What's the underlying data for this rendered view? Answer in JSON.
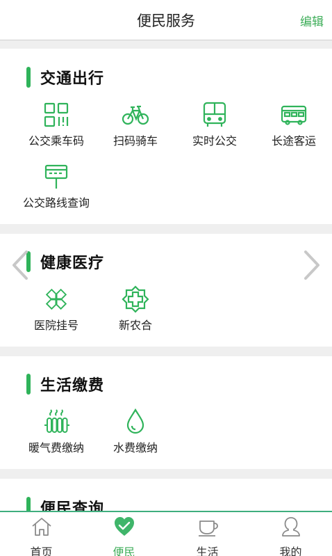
{
  "header": {
    "title": "便民服务",
    "edit_label": "编辑"
  },
  "colors": {
    "accent": "#2fb35a",
    "accent_light": "#3fae5a",
    "inactive": "#888888"
  },
  "sections": [
    {
      "title": "交通出行",
      "items": [
        {
          "label": "公交乘车码",
          "icon": "qr-code-icon"
        },
        {
          "label": "扫码骑车",
          "icon": "bicycle-icon"
        },
        {
          "label": "实时公交",
          "icon": "bus-icon"
        },
        {
          "label": "长途客运",
          "icon": "coach-icon"
        },
        {
          "label": "公交路线查询",
          "icon": "bus-stop-sign-icon"
        }
      ]
    },
    {
      "title": "健康医疗",
      "items": [
        {
          "label": "医院挂号",
          "icon": "medical-cross-icon"
        },
        {
          "label": "新农合",
          "icon": "health-badge-icon"
        }
      ]
    },
    {
      "title": "生活缴费",
      "items": [
        {
          "label": "暖气费缴纳",
          "icon": "radiator-icon"
        },
        {
          "label": "水费缴纳",
          "icon": "water-drop-icon"
        }
      ]
    },
    {
      "title": "便民查询",
      "items": []
    }
  ],
  "tabbar": [
    {
      "label": "首页",
      "icon": "home-icon",
      "active": false
    },
    {
      "label": "便民",
      "icon": "heart-icon",
      "active": true
    },
    {
      "label": "生活",
      "icon": "coffee-cup-icon",
      "active": false
    },
    {
      "label": "我的",
      "icon": "person-icon",
      "active": false
    }
  ]
}
